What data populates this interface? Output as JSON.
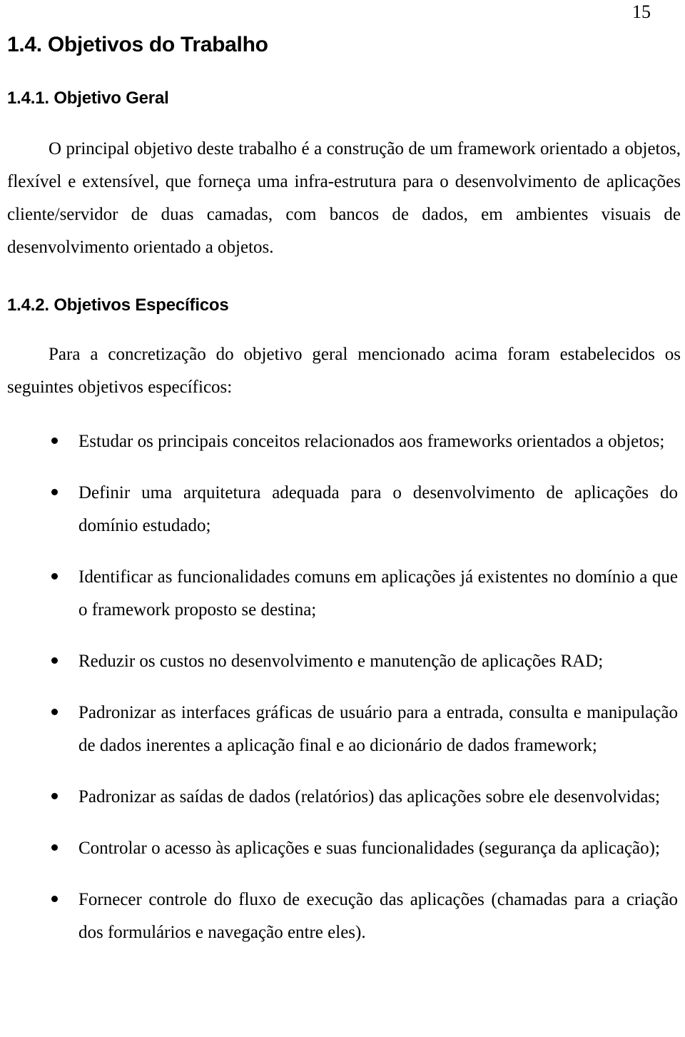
{
  "page": {
    "number": "15"
  },
  "section": {
    "heading": "1.4. Objetivos do Trabalho"
  },
  "general_objective": {
    "heading": "1.4.1. Objetivo Geral",
    "paragraph": "O principal objetivo deste trabalho é a construção de um framework orientado a objetos, flexível e extensível, que forneça uma infra-estrutura para o desenvolvimento de aplicações cliente/servidor de duas camadas, com bancos de dados, em ambientes visuais de desenvolvimento orientado a objetos."
  },
  "specific_objectives": {
    "heading": "1.4.2. Objetivos Específicos",
    "intro": "Para a concretização do objetivo geral mencionado acima foram estabelecidos os seguintes objetivos específicos:",
    "items": [
      "Estudar os principais conceitos relacionados aos frameworks orientados a objetos;",
      "Definir uma arquitetura adequada para o desenvolvimento de aplicações do domínio estudado;",
      "Identificar as funcionalidades comuns em aplicações já existentes no domínio a que o framework proposto se destina;",
      "Reduzir os custos no desenvolvimento e manutenção de aplicações RAD;",
      "Padronizar as interfaces gráficas de usuário para a entrada, consulta e manipulação de dados inerentes a aplicação final e ao dicionário de dados framework;",
      "Padronizar as saídas de dados (relatórios) das aplicações sobre ele desenvolvidas;",
      "Controlar o acesso às aplicações e suas funcionalidades (segurança da aplicação);",
      "Fornecer controle do fluxo de execução das aplicações (chamadas para a criação dos formulários e navegação entre eles)."
    ]
  },
  "colors": {
    "text": "#000000",
    "background": "#ffffff"
  }
}
